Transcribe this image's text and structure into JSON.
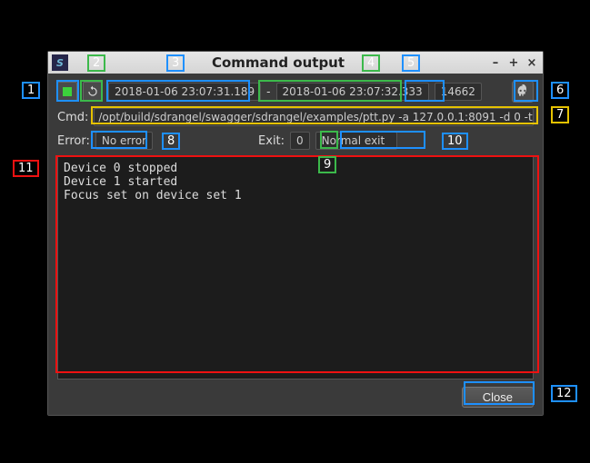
{
  "window": {
    "title": "Command output",
    "app_icon_letter": "S"
  },
  "toolbar": {
    "start_time": "2018-01-06 23:07:31.189",
    "end_time": "2018-01-06 23:07:32.333",
    "pid": "14662",
    "cmd_label": "Cmd:",
    "cmd_value": "/opt/build/sdrangel/swagger/sdrangel/examples/ptt.py -a 127.0.0.1:8091 -d 0 -t"
  },
  "status": {
    "error_label": "Error:",
    "error_value": "No error",
    "exit_label": "Exit:",
    "exit_code": "0",
    "exit_text": "Normal exit"
  },
  "log": "Device 0 stopped\nDevice 1 started\nFocus set on device set 1",
  "buttons": {
    "close": "Close"
  },
  "callouts": {
    "n1": "1",
    "n2": "2",
    "n3": "3",
    "n4": "4",
    "n5": "5",
    "n6": "6",
    "n7": "7",
    "n8": "8",
    "n9": "9",
    "n10": "10",
    "n11": "11",
    "n12": "12"
  }
}
